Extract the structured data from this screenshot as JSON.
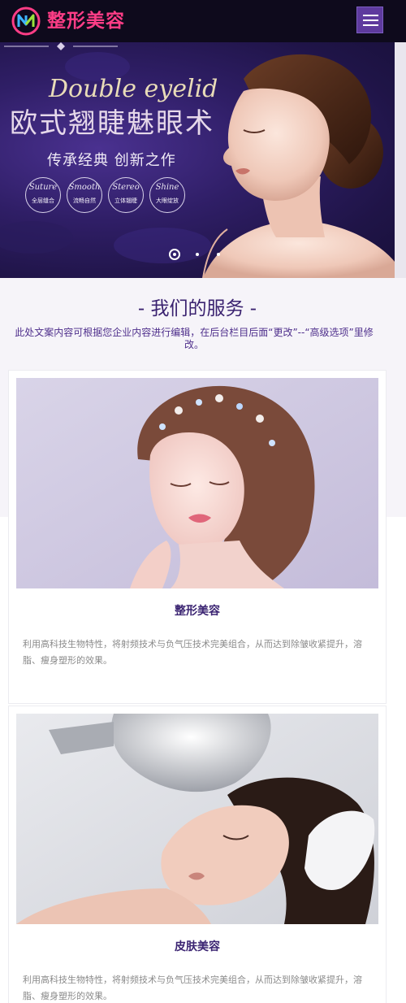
{
  "header": {
    "brand": "整形美容",
    "logo_icon": "nm-logo-icon",
    "menu_icon": "hamburger-menu-icon"
  },
  "banner": {
    "script_text": "Double eyelid",
    "title": "欧式翘睫魅眼术",
    "subtitle": "传承经典 创新之作",
    "badges": [
      {
        "en": "Suture",
        "cn": "全层缝合"
      },
      {
        "en": "Smooth",
        "cn": "流畅自然"
      },
      {
        "en": "Stereo",
        "cn": "立体翘睫"
      },
      {
        "en": "Shine",
        "cn": "大眼绽放"
      }
    ],
    "slides": 3,
    "active_slide": 1
  },
  "services": {
    "title": "- 我们的服务 -",
    "description": "此处文案内容可根据您企业内容进行编辑，在后台栏目后面“更改”--“高级选项”里修改。",
    "items": [
      {
        "title": "整形美容",
        "text": "利用高科技生物特性，将射频技术与负气压技术完美组合，从而达到除皱收紧提升，溶脂、瘦身塑形的效果。"
      },
      {
        "title": "皮肤美容",
        "text": "利用高科技生物特性，将射频技术与负气压技术完美组合，从而达到除皱收紧提升，溶脂、瘦身塑形的效果。"
      }
    ]
  },
  "colors": {
    "header_bg": "#0e0a1c",
    "brand_pink": "#ff3d86",
    "menu_purple": "#5e3a9e",
    "title_purple": "#3a2270"
  }
}
